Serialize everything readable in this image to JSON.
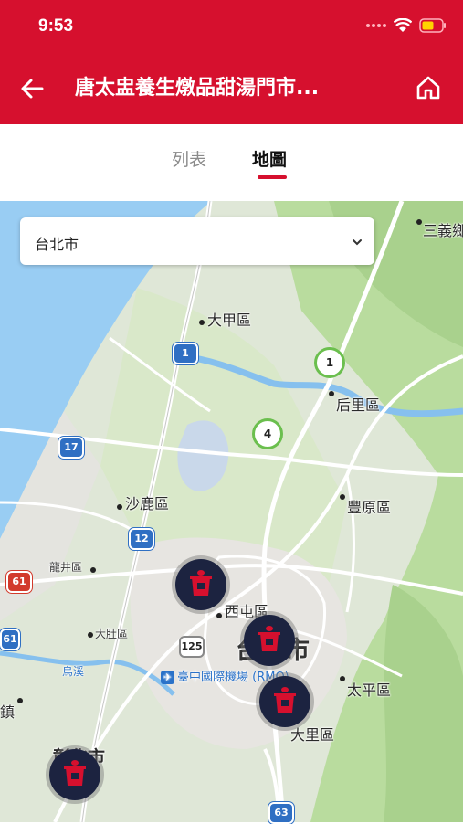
{
  "status": {
    "time": "9:53",
    "icons": [
      "signal-icon",
      "wifi-icon",
      "battery-icon"
    ]
  },
  "header": {
    "title": "唐太盅養生燉品甜湯門市...",
    "back_icon": "back-arrow-icon",
    "home_icon": "home-icon"
  },
  "tabs": [
    {
      "label": "列表",
      "active": false
    },
    {
      "label": "地圖",
      "active": true
    }
  ],
  "filter": {
    "selected": "台北市"
  },
  "map": {
    "places": {
      "sanyi": "三義鄉",
      "dajia": "大甲區",
      "houli": "后里區",
      "airport": "臺中國際機場 (RMQ)",
      "shalu": "沙鹿區",
      "fengyuan": "豐原區",
      "longjing": "龍井區",
      "xitun": "西屯區",
      "city": "台中市",
      "dadu": "大肚區",
      "wuxi": "烏溪",
      "taiping": "太平區",
      "dali": "大里區",
      "zhen": "鎮",
      "changhua": "彰化市"
    },
    "routes": {
      "r1": "1",
      "r17": "17",
      "r12": "12",
      "r61": "61",
      "r61b": "61",
      "r125": "125",
      "r63": "63",
      "h1": "1",
      "h4": "4"
    }
  },
  "colors": {
    "brand": "#d6102e",
    "marker": "#1c2340"
  }
}
